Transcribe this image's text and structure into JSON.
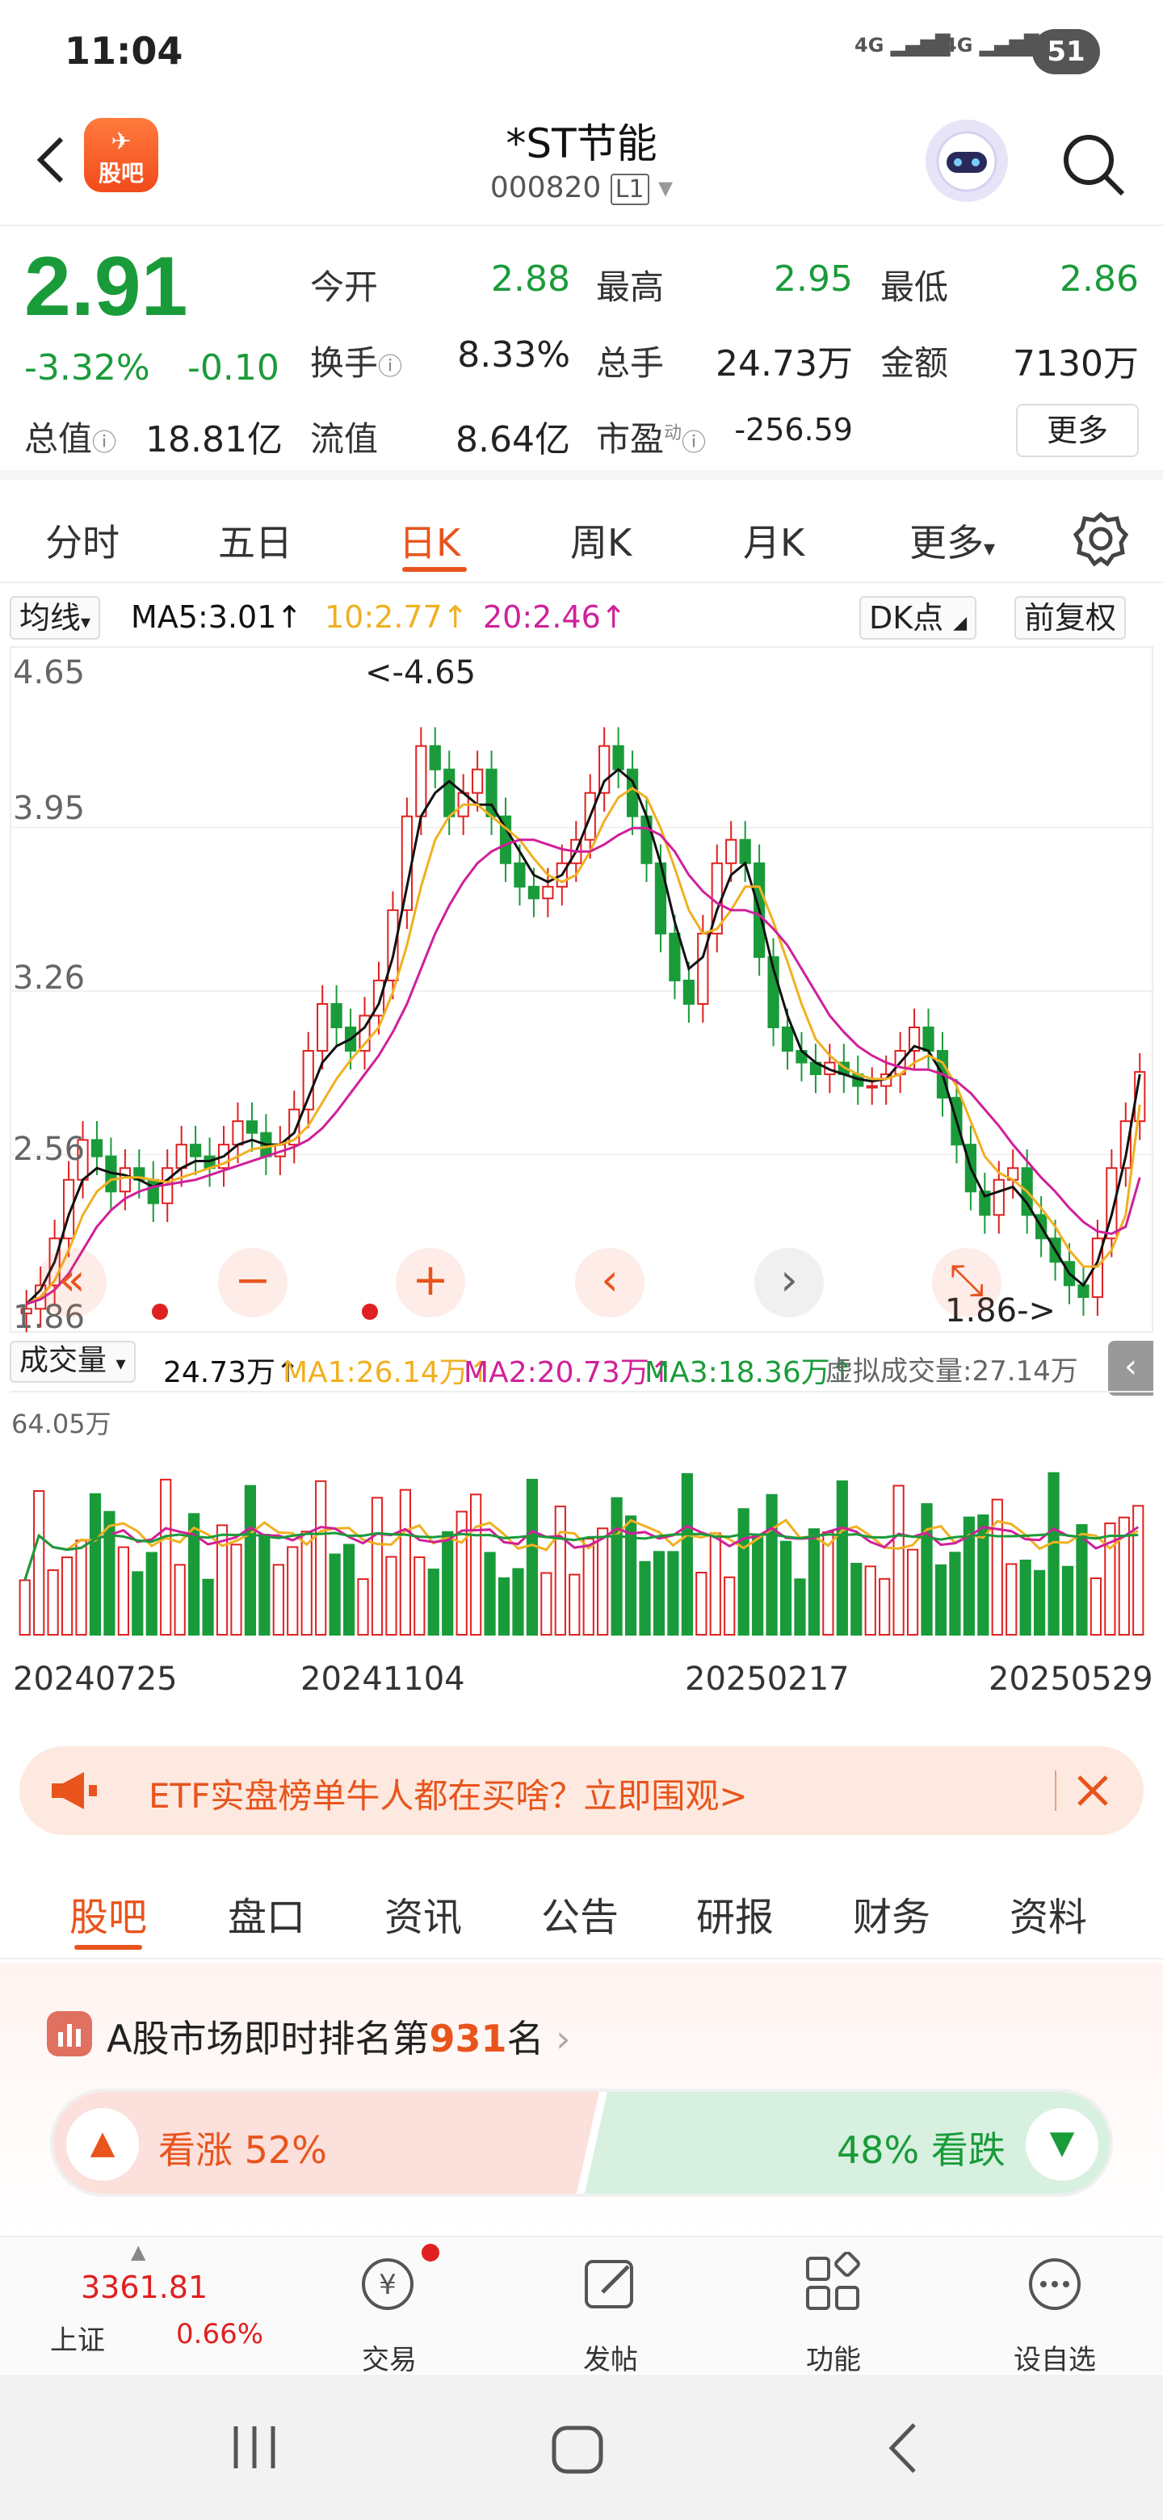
{
  "status_bar": {
    "time": "11:04",
    "signal1": "4G",
    "signal2": "4G",
    "battery": "51"
  },
  "header": {
    "title": "*ST节能",
    "code": "000820",
    "level": "L1",
    "logo_text": "股吧"
  },
  "quote": {
    "price": "2.91",
    "change_pct": "-3.32%",
    "change": "-0.10",
    "stats": [
      {
        "label": "今开",
        "value": "2.88",
        "green": true
      },
      {
        "label": "最高",
        "value": "2.95",
        "green": true
      },
      {
        "label": "最低",
        "value": "2.86",
        "green": true
      },
      {
        "label": "换手",
        "value": "8.33%",
        "green": false
      },
      {
        "label": "总手",
        "value": "24.73万",
        "green": false
      },
      {
        "label": "金额",
        "value": "7130万",
        "green": false
      },
      {
        "label": "总值",
        "value": "18.81亿",
        "green": false
      },
      {
        "label": "流值",
        "value": "8.64亿",
        "green": false
      },
      {
        "label": "市盈",
        "value": "-256.59",
        "green": false
      }
    ],
    "pe_mark": "动",
    "more": "更多"
  },
  "kline_tabs": [
    "分时",
    "五日",
    "日K",
    "周K",
    "月K",
    "更多"
  ],
  "active_tab": "日K",
  "ma_bar": {
    "type": "均线",
    "ma5": "MA5:3.01",
    "ma10": "10:2.77",
    "ma20": "20:2.46",
    "dk": "DK点",
    "adjust": "前复权"
  },
  "colors": {
    "accent": "#e8541c",
    "up": "#e02020",
    "down": "#1a9b3a",
    "ma5": "#111111",
    "ma10": "#f0b020",
    "ma20": "#d0209a",
    "vma3": "#1a9b3a"
  },
  "volume_bar": {
    "label": "成交量",
    "vol": "24.73万",
    "ma1": "MA1:26.14万",
    "ma2": "MA2:20.73万",
    "ma3": "MA3:18.36万",
    "virtual": "虚拟成交量:27.14万",
    "max": "64.05万"
  },
  "chart_data": {
    "type": "candlestick",
    "y_ticks": [
      "4.65",
      "3.95",
      "3.26",
      "2.56",
      "1.86"
    ],
    "ylim": [
      1.86,
      4.65
    ],
    "high_label": "<-4.65",
    "low_label": "1.86->",
    "x_ticks": [
      "20240725",
      "20241104",
      "20250217",
      "20250529"
    ],
    "close": [
      1.9,
      2.0,
      2.2,
      2.45,
      2.62,
      2.55,
      2.4,
      2.5,
      2.45,
      2.35,
      2.5,
      2.6,
      2.55,
      2.5,
      2.6,
      2.7,
      2.65,
      2.55,
      2.6,
      2.75,
      3.0,
      3.2,
      3.1,
      3.0,
      3.15,
      3.3,
      3.6,
      4.0,
      4.3,
      4.2,
      4.0,
      4.1,
      4.2,
      4.0,
      3.8,
      3.7,
      3.65,
      3.7,
      3.8,
      3.9,
      4.1,
      4.3,
      4.2,
      4.0,
      3.8,
      3.5,
      3.3,
      3.2,
      3.5,
      3.8,
      3.9,
      3.8,
      3.4,
      3.1,
      3.0,
      2.95,
      2.9,
      2.95,
      2.9,
      2.85,
      2.85,
      2.9,
      3.0,
      3.1,
      3.0,
      2.8,
      2.6,
      2.4,
      2.3,
      2.45,
      2.5,
      2.3,
      2.2,
      2.1,
      2.0,
      1.95,
      2.2,
      2.5,
      2.7,
      2.91
    ],
    "ma5": [
      1.92,
      1.98,
      2.1,
      2.3,
      2.45,
      2.5,
      2.48,
      2.47,
      2.45,
      2.42,
      2.45,
      2.5,
      2.53,
      2.53,
      2.55,
      2.6,
      2.62,
      2.6,
      2.6,
      2.65,
      2.8,
      2.95,
      3.02,
      3.05,
      3.1,
      3.2,
      3.4,
      3.7,
      4.0,
      4.1,
      4.15,
      4.1,
      4.05,
      4.05,
      3.95,
      3.85,
      3.75,
      3.72,
      3.75,
      3.85,
      4.0,
      4.15,
      4.2,
      4.15,
      4.0,
      3.8,
      3.55,
      3.35,
      3.4,
      3.6,
      3.75,
      3.8,
      3.6,
      3.35,
      3.15,
      3.0,
      2.95,
      2.92,
      2.9,
      2.88,
      2.87,
      2.88,
      2.95,
      3.02,
      3.0,
      2.9,
      2.7,
      2.5,
      2.38,
      2.4,
      2.42,
      2.35,
      2.25,
      2.15,
      2.05,
      2.0,
      2.1,
      2.3,
      2.55,
      2.9
    ],
    "ma10": [
      1.92,
      1.95,
      2.02,
      2.15,
      2.3,
      2.4,
      2.45,
      2.46,
      2.46,
      2.45,
      2.44,
      2.46,
      2.48,
      2.5,
      2.52,
      2.55,
      2.58,
      2.59,
      2.6,
      2.62,
      2.68,
      2.78,
      2.88,
      2.96,
      3.03,
      3.1,
      3.25,
      3.45,
      3.7,
      3.9,
      4.0,
      4.05,
      4.05,
      4.0,
      3.95,
      3.9,
      3.82,
      3.75,
      3.72,
      3.75,
      3.85,
      3.98,
      4.08,
      4.12,
      4.08,
      3.95,
      3.78,
      3.6,
      3.5,
      3.52,
      3.6,
      3.7,
      3.7,
      3.55,
      3.38,
      3.2,
      3.05,
      2.98,
      2.93,
      2.9,
      2.88,
      2.88,
      2.9,
      2.95,
      2.98,
      2.95,
      2.85,
      2.7,
      2.55,
      2.48,
      2.45,
      2.4,
      2.33,
      2.25,
      2.15,
      2.08,
      2.08,
      2.15,
      2.3,
      2.77
    ],
    "ma20": [
      1.92,
      1.94,
      1.98,
      2.05,
      2.15,
      2.25,
      2.32,
      2.37,
      2.4,
      2.42,
      2.43,
      2.44,
      2.45,
      2.47,
      2.49,
      2.51,
      2.53,
      2.55,
      2.57,
      2.59,
      2.62,
      2.67,
      2.74,
      2.82,
      2.9,
      2.98,
      3.08,
      3.2,
      3.35,
      3.5,
      3.62,
      3.72,
      3.8,
      3.85,
      3.88,
      3.9,
      3.9,
      3.88,
      3.86,
      3.85,
      3.85,
      3.88,
      3.92,
      3.95,
      3.95,
      3.92,
      3.85,
      3.75,
      3.68,
      3.63,
      3.6,
      3.6,
      3.58,
      3.52,
      3.45,
      3.35,
      3.25,
      3.15,
      3.08,
      3.02,
      2.98,
      2.95,
      2.93,
      2.92,
      2.92,
      2.9,
      2.87,
      2.82,
      2.75,
      2.68,
      2.6,
      2.53,
      2.46,
      2.4,
      2.33,
      2.27,
      2.23,
      2.22,
      2.25,
      2.46
    ]
  },
  "ad_banner": {
    "text": "ETF实盘榜单牛人都在买啥？立即围观>"
  },
  "guba_tabs": [
    "股吧",
    "盘口",
    "资讯",
    "公告",
    "研报",
    "财务",
    "资料"
  ],
  "rank": {
    "prefix": "A股市场即时排名第",
    "number": "931",
    "suffix": "名"
  },
  "vote": {
    "up": "看涨 52%",
    "down": "48% 看跌"
  },
  "bottom_nav": {
    "index_value": "3361.81",
    "index_name": "上证",
    "index_pct": "0.66%",
    "items": [
      "交易",
      "发帖",
      "功能",
      "设自选"
    ]
  }
}
